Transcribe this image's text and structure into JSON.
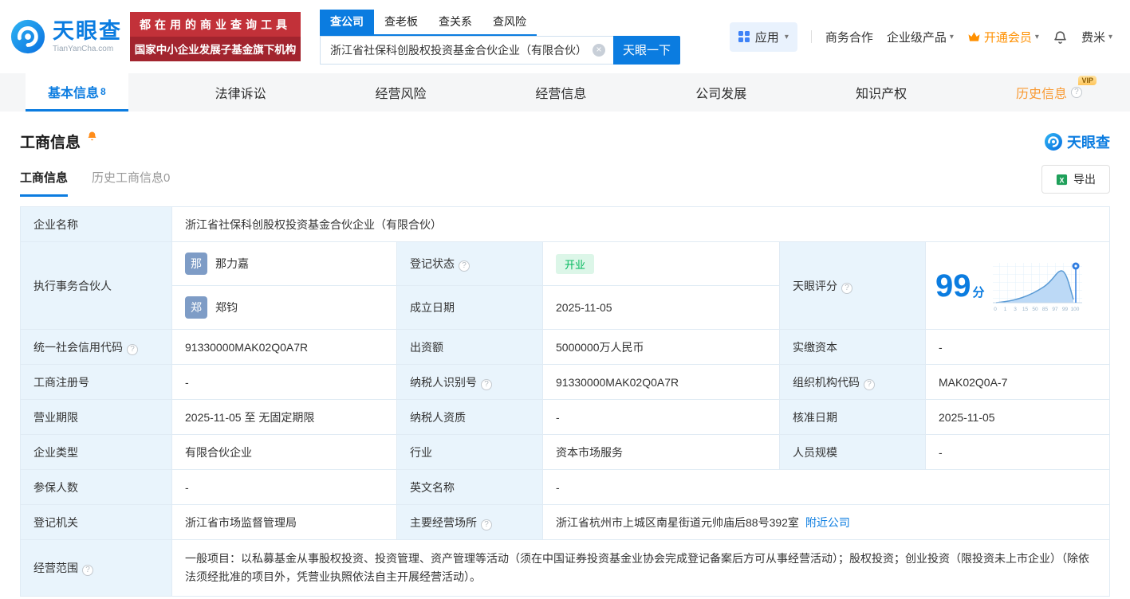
{
  "header": {
    "logo": {
      "name": "天眼查",
      "domain": "TianYanCha.com"
    },
    "promo": {
      "line1": "都在用的商业查询工具",
      "line2": "国家中小企业发展子基金旗下机构"
    },
    "search_tabs": [
      {
        "label": "查公司"
      },
      {
        "label": "查老板"
      },
      {
        "label": "查关系"
      },
      {
        "label": "查风险"
      }
    ],
    "search": {
      "value": "浙江省社保科创股权投资基金合伙企业（有限合伙）",
      "button_label": "天眼一下"
    },
    "nav": {
      "apps": "应用",
      "cooperation": "商务合作",
      "enterprise": "企业级产品",
      "vip": "开通会员",
      "user": "费米"
    }
  },
  "main_tabs": [
    {
      "label": "基本信息",
      "badge": "8"
    },
    {
      "label": "法律诉讼"
    },
    {
      "label": "经营风险"
    },
    {
      "label": "经营信息"
    },
    {
      "label": "公司发展"
    },
    {
      "label": "知识产权"
    },
    {
      "label": "历史信息",
      "vip_tag": "VIP"
    }
  ],
  "section": {
    "title": "工商信息",
    "brand": "天眼查",
    "subtabs": [
      {
        "label": "工商信息"
      },
      {
        "label": "历史工商信息0"
      }
    ],
    "export_label": "导出"
  },
  "info": {
    "company_name_label": "企业名称",
    "company_name": "浙江省社保科创股权投资基金合伙企业（有限合伙）",
    "partner_label": "执行事务合伙人",
    "partners": [
      {
        "avatar": "那",
        "name": "那力嘉"
      },
      {
        "avatar": "郑",
        "name": "郑钧"
      }
    ],
    "reg_status_label": "登记状态",
    "reg_status": "开业",
    "establish_label": "成立日期",
    "establish_date": "2025-11-05",
    "score_label": "天眼评分",
    "score": "99",
    "score_unit": "分",
    "score_axis": [
      "0",
      "1",
      "3",
      "15",
      "50",
      "85",
      "97",
      "99",
      "100"
    ],
    "credit_code_label": "统一社会信用代码",
    "credit_code": "91330000MAK02Q0A7R",
    "capital_label": "出资额",
    "capital": "5000000万人民币",
    "paid_capital_label": "实缴资本",
    "paid_capital": "-",
    "reg_no_label": "工商注册号",
    "reg_no": "-",
    "taxpayer_id_label": "纳税人识别号",
    "taxpayer_id": "91330000MAK02Q0A7R",
    "org_code_label": "组织机构代码",
    "org_code": "MAK02Q0A-7",
    "term_label": "营业期限",
    "term": "2025-11-05 至 无固定期限",
    "taxpayer_quality_label": "纳税人资质",
    "taxpayer_quality": "-",
    "approve_date_label": "核准日期",
    "approve_date": "2025-11-05",
    "company_type_label": "企业类型",
    "company_type": "有限合伙企业",
    "industry_label": "行业",
    "industry": "资本市场服务",
    "staff_label": "人员规模",
    "staff": "-",
    "insured_label": "参保人数",
    "insured": "-",
    "english_name_label": "英文名称",
    "english_name": "-",
    "authority_label": "登记机关",
    "authority": "浙江省市场监督管理局",
    "address_label": "主要经营场所",
    "address": "浙江省杭州市上城区南星街道元帅庙后88号392室",
    "nearby_link": "附近公司",
    "scope_label": "经营范围",
    "scope": "一般项目：以私募基金从事股权投资、投资管理、资产管理等活动（须在中国证券投资基金业协会完成登记备案后方可从事经营活动）；股权投资；创业投资（限投资未上市企业）（除依法须经批准的项目外，凭营业执照依法自主开展经营活动）。"
  }
}
